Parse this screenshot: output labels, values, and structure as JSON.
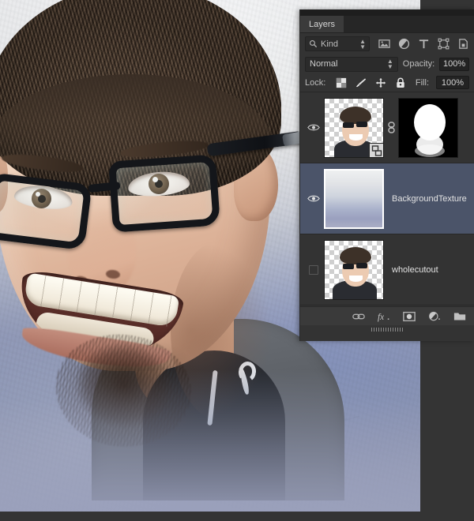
{
  "app": {
    "panel_title": "Layers"
  },
  "panel": {
    "tab_label": "Layers",
    "filter": {
      "kind_label": "Kind",
      "search_icon": "search-icon",
      "icons": [
        {
          "name": "filter-pixel-icon",
          "title": "Filter for pixel layers"
        },
        {
          "name": "filter-adjustment-icon",
          "title": "Filter for adjustment layers"
        },
        {
          "name": "filter-type-icon",
          "title": "Filter for type layers"
        },
        {
          "name": "filter-shape-icon",
          "title": "Filter for shape layers"
        },
        {
          "name": "filter-smart-object-icon",
          "title": "Filter for smart objects"
        }
      ]
    },
    "blend": {
      "mode": "Normal",
      "opacity_label": "Opacity:",
      "opacity_value": "100%"
    },
    "lock": {
      "label": "Lock:",
      "fill_label": "Fill:",
      "fill_value": "100%",
      "icons": [
        {
          "name": "lock-transparent-pixels-icon"
        },
        {
          "name": "lock-image-pixels-icon"
        },
        {
          "name": "lock-position-icon"
        },
        {
          "name": "lock-all-icon"
        }
      ]
    },
    "layers": [
      {
        "name": "",
        "visible": true,
        "selected": false,
        "has_mask": true,
        "linked": true,
        "is_smart_object": true,
        "thumb_kind": "cutout-portrait",
        "mask_kind": "white-head-silhouette"
      },
      {
        "name": "BackgroundTexture",
        "visible": true,
        "selected": true,
        "has_mask": false,
        "linked": false,
        "is_smart_object": false,
        "thumb_kind": "texture"
      },
      {
        "name": "wholecutout",
        "visible": false,
        "selected": false,
        "has_mask": false,
        "linked": false,
        "is_smart_object": false,
        "thumb_kind": "cutout-portrait"
      },
      {
        "name": "",
        "visible": false,
        "selected": false,
        "has_mask": false,
        "linked": false,
        "is_smart_object": false,
        "thumb_kind": "white-partial"
      }
    ],
    "footer_buttons": [
      {
        "name": "link-layers-button",
        "glyph": "link"
      },
      {
        "name": "layer-style-fx-button",
        "glyph": "fx"
      },
      {
        "name": "add-layer-mask-button",
        "glyph": "mask"
      },
      {
        "name": "new-adjustment-layer-button",
        "glyph": "adjustment"
      },
      {
        "name": "new-group-button",
        "glyph": "folder"
      }
    ]
  },
  "canvas": {
    "description": "Portrait of a smiling man with dark-rimmed glasses composited on a mottled blue-grey concrete texture background"
  },
  "colors": {
    "panel_bg": "#333333",
    "panel_tab_bg": "#3b3b3b",
    "selected_layer_bg": "#4b5469",
    "field_bg": "#232323",
    "text": "#c9c9c9",
    "workspace_bg": "#343434"
  }
}
